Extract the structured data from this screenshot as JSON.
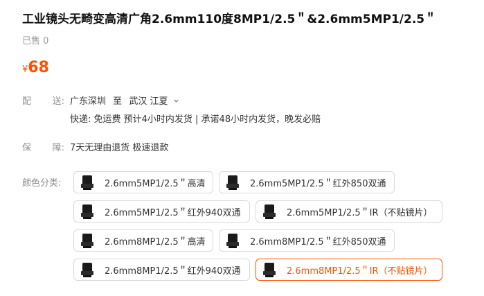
{
  "product": {
    "title": "工业镜头无畸变高清广角2.6mm110度8MP1/2.5＂&2.6mm5MP1/2.5＂",
    "sold": "已售 0",
    "currency": "¥",
    "price": "68"
  },
  "shipping": {
    "label_chars": [
      "配",
      "送:"
    ],
    "from": "广东深圳",
    "to_word": "至",
    "dest": "武汉 江夏",
    "info": "快递: 免运费  预计4小时内发货 | 承诺48小时内发货，晚发必赔"
  },
  "guarantee": {
    "label_chars": [
      "保",
      "障:"
    ],
    "text": "7天无理由退货 极速退款"
  },
  "options": {
    "label": "颜色分类:",
    "items": [
      {
        "label": "2.6mm5MP1/2.5＂高清",
        "selected": false
      },
      {
        "label": "2.6mm5MP1/2.5＂红外850双通",
        "selected": false
      },
      {
        "label": "2.6mm5MP1/2.5＂红外940双通",
        "selected": false
      },
      {
        "label": "2.6mm5MP1/2.5＂IR（不贴镜片）",
        "selected": false
      },
      {
        "label": "2.6mm8MP1/2.5＂高清",
        "selected": false
      },
      {
        "label": "2.6mm8MP1/2.5＂红外850双通",
        "selected": false
      },
      {
        "label": "2.6mm8MP1/2.5＂红外940双通",
        "selected": false
      },
      {
        "label": "2.6mm8MP1/2.5＂IR（不贴镜片）",
        "selected": true
      }
    ]
  },
  "colors": {
    "accent": "#ff5000",
    "border": "#d9d9d9"
  },
  "icons": {
    "option_thumb": "lens-thumbnail-icon",
    "chevron": "chevron-down-icon"
  }
}
